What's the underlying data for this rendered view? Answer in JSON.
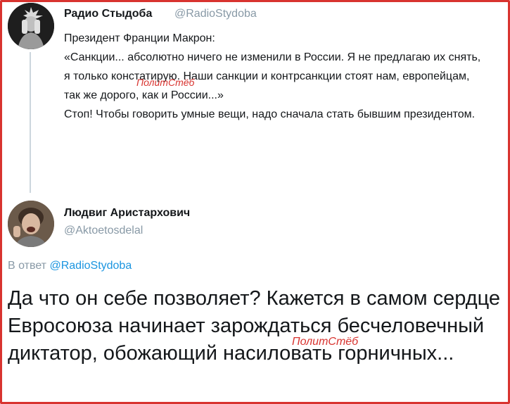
{
  "tweet1": {
    "author_name": "Радио Стыдоба",
    "author_handle": "@RadioStydoba",
    "lines": [
      "Президент Франции Макрон:",
      "«Санкции... абсолютно ничего не изменили в России. Я не предлагаю их снять, я только констатирую. Наши санкции и контрсанкции стоят нам, европейцам, так же дорого, как и России...»",
      "Стоп! Чтобы говорить умные вещи, надо сначала стать бывшим президентом."
    ]
  },
  "tweet2": {
    "author_name": "Людвиг Аристархович",
    "author_handle": "@Aktoetosdelal",
    "reply_prefix": "В ответ",
    "reply_handle": "@RadioStydoba",
    "text": "Да что он себе позволяет? Кажется в самом сердце Евросоюза начинает зарождаться бесчеловечный диктатор, обожающий насиловать горничных..."
  },
  "watermark": "ПолитСтёб",
  "colors": {
    "frame": "#d8332f",
    "link": "#1b95e0",
    "muted": "#8899a6",
    "text": "#14171a"
  }
}
